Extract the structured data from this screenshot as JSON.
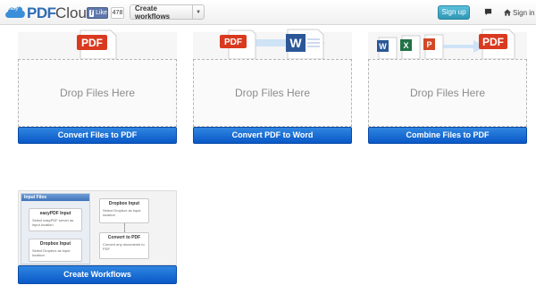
{
  "header": {
    "logo_easy": "easy",
    "logo_pdf": "PDF",
    "logo_cloud": "Cloud",
    "fb_like_label": "Like",
    "fb_like_count": "478",
    "workflows_dropdown_label": "Create workflows",
    "signup_label": "Sign up",
    "signin_label": "Sign in"
  },
  "cards": [
    {
      "drop_label": "Drop Files Here",
      "action_label": "Convert Files to PDF",
      "art_badge": "PDF"
    },
    {
      "drop_label": "Drop Files Here",
      "action_label": "Convert PDF to Word",
      "art_badge": "PDF"
    },
    {
      "drop_label": "Drop Files Here",
      "action_label": "Combine Files to PDF",
      "art_badge": "PDF"
    }
  ],
  "workflow_card": {
    "button_label": "Create Workflows",
    "panel_title": "Input Files",
    "nodes": [
      {
        "title": "easyPDF Input",
        "desc": "Select easyPDF server as input location"
      },
      {
        "title": "Dropbox Input",
        "desc": "Select Dropbox as input location"
      },
      {
        "title": "Dropbox Input",
        "desc": "Select Dropbox as input location"
      },
      {
        "title": "Convert to PDF",
        "desc": "Convert any documents to PDF"
      }
    ]
  },
  "colors": {
    "primary_button": "#1a6fd6",
    "signup": "#3fa8cc",
    "pdf_red": "#d9391e",
    "word_blue": "#2b5797"
  }
}
